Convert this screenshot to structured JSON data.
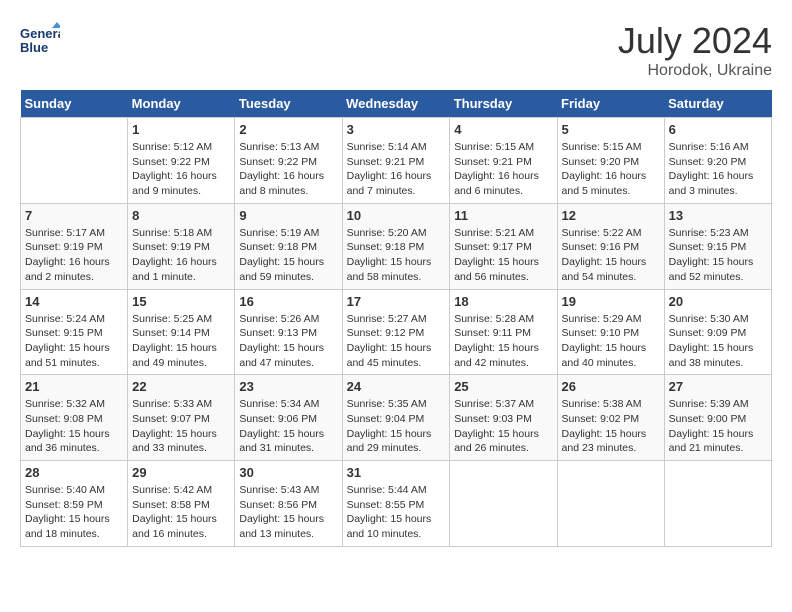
{
  "logo": {
    "line1": "General",
    "line2": "Blue"
  },
  "title": "July 2024",
  "subtitle": "Horodok, Ukraine",
  "days_header": [
    "Sunday",
    "Monday",
    "Tuesday",
    "Wednesday",
    "Thursday",
    "Friday",
    "Saturday"
  ],
  "weeks": [
    [
      {
        "day": "",
        "info": ""
      },
      {
        "day": "1",
        "info": "Sunrise: 5:12 AM\nSunset: 9:22 PM\nDaylight: 16 hours\nand 9 minutes."
      },
      {
        "day": "2",
        "info": "Sunrise: 5:13 AM\nSunset: 9:22 PM\nDaylight: 16 hours\nand 8 minutes."
      },
      {
        "day": "3",
        "info": "Sunrise: 5:14 AM\nSunset: 9:21 PM\nDaylight: 16 hours\nand 7 minutes."
      },
      {
        "day": "4",
        "info": "Sunrise: 5:15 AM\nSunset: 9:21 PM\nDaylight: 16 hours\nand 6 minutes."
      },
      {
        "day": "5",
        "info": "Sunrise: 5:15 AM\nSunset: 9:20 PM\nDaylight: 16 hours\nand 5 minutes."
      },
      {
        "day": "6",
        "info": "Sunrise: 5:16 AM\nSunset: 9:20 PM\nDaylight: 16 hours\nand 3 minutes."
      }
    ],
    [
      {
        "day": "7",
        "info": "Sunrise: 5:17 AM\nSunset: 9:19 PM\nDaylight: 16 hours\nand 2 minutes."
      },
      {
        "day": "8",
        "info": "Sunrise: 5:18 AM\nSunset: 9:19 PM\nDaylight: 16 hours\nand 1 minute."
      },
      {
        "day": "9",
        "info": "Sunrise: 5:19 AM\nSunset: 9:18 PM\nDaylight: 15 hours\nand 59 minutes."
      },
      {
        "day": "10",
        "info": "Sunrise: 5:20 AM\nSunset: 9:18 PM\nDaylight: 15 hours\nand 58 minutes."
      },
      {
        "day": "11",
        "info": "Sunrise: 5:21 AM\nSunset: 9:17 PM\nDaylight: 15 hours\nand 56 minutes."
      },
      {
        "day": "12",
        "info": "Sunrise: 5:22 AM\nSunset: 9:16 PM\nDaylight: 15 hours\nand 54 minutes."
      },
      {
        "day": "13",
        "info": "Sunrise: 5:23 AM\nSunset: 9:15 PM\nDaylight: 15 hours\nand 52 minutes."
      }
    ],
    [
      {
        "day": "14",
        "info": "Sunrise: 5:24 AM\nSunset: 9:15 PM\nDaylight: 15 hours\nand 51 minutes."
      },
      {
        "day": "15",
        "info": "Sunrise: 5:25 AM\nSunset: 9:14 PM\nDaylight: 15 hours\nand 49 minutes."
      },
      {
        "day": "16",
        "info": "Sunrise: 5:26 AM\nSunset: 9:13 PM\nDaylight: 15 hours\nand 47 minutes."
      },
      {
        "day": "17",
        "info": "Sunrise: 5:27 AM\nSunset: 9:12 PM\nDaylight: 15 hours\nand 45 minutes."
      },
      {
        "day": "18",
        "info": "Sunrise: 5:28 AM\nSunset: 9:11 PM\nDaylight: 15 hours\nand 42 minutes."
      },
      {
        "day": "19",
        "info": "Sunrise: 5:29 AM\nSunset: 9:10 PM\nDaylight: 15 hours\nand 40 minutes."
      },
      {
        "day": "20",
        "info": "Sunrise: 5:30 AM\nSunset: 9:09 PM\nDaylight: 15 hours\nand 38 minutes."
      }
    ],
    [
      {
        "day": "21",
        "info": "Sunrise: 5:32 AM\nSunset: 9:08 PM\nDaylight: 15 hours\nand 36 minutes."
      },
      {
        "day": "22",
        "info": "Sunrise: 5:33 AM\nSunset: 9:07 PM\nDaylight: 15 hours\nand 33 minutes."
      },
      {
        "day": "23",
        "info": "Sunrise: 5:34 AM\nSunset: 9:06 PM\nDaylight: 15 hours\nand 31 minutes."
      },
      {
        "day": "24",
        "info": "Sunrise: 5:35 AM\nSunset: 9:04 PM\nDaylight: 15 hours\nand 29 minutes."
      },
      {
        "day": "25",
        "info": "Sunrise: 5:37 AM\nSunset: 9:03 PM\nDaylight: 15 hours\nand 26 minutes."
      },
      {
        "day": "26",
        "info": "Sunrise: 5:38 AM\nSunset: 9:02 PM\nDaylight: 15 hours\nand 23 minutes."
      },
      {
        "day": "27",
        "info": "Sunrise: 5:39 AM\nSunset: 9:00 PM\nDaylight: 15 hours\nand 21 minutes."
      }
    ],
    [
      {
        "day": "28",
        "info": "Sunrise: 5:40 AM\nSunset: 8:59 PM\nDaylight: 15 hours\nand 18 minutes."
      },
      {
        "day": "29",
        "info": "Sunrise: 5:42 AM\nSunset: 8:58 PM\nDaylight: 15 hours\nand 16 minutes."
      },
      {
        "day": "30",
        "info": "Sunrise: 5:43 AM\nSunset: 8:56 PM\nDaylight: 15 hours\nand 13 minutes."
      },
      {
        "day": "31",
        "info": "Sunrise: 5:44 AM\nSunset: 8:55 PM\nDaylight: 15 hours\nand 10 minutes."
      },
      {
        "day": "",
        "info": ""
      },
      {
        "day": "",
        "info": ""
      },
      {
        "day": "",
        "info": ""
      }
    ]
  ]
}
